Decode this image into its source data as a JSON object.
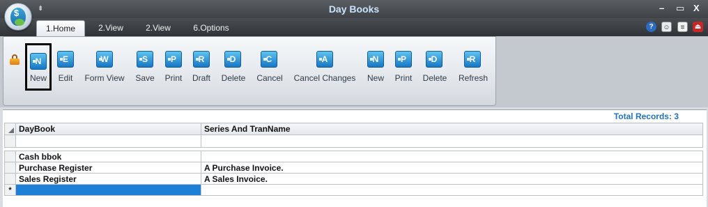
{
  "window": {
    "title": "Day Books",
    "controls": {
      "minimize": "–",
      "restore": "▭",
      "close": "X"
    },
    "qat_arrow": "⇟"
  },
  "tabs": [
    {
      "label": "1.Home",
      "active": true
    },
    {
      "label": "2.View",
      "active": false
    },
    {
      "label": "2.View",
      "active": false
    },
    {
      "label": "6.Options",
      "active": false
    }
  ],
  "topright_icons": [
    "help-icon",
    "contact-icon",
    "document-icon",
    "exit-icon"
  ],
  "ribbon": {
    "buttons": [
      {
        "label": "New",
        "letter": "N",
        "selected": true
      },
      {
        "label": "Edit",
        "letter": "E"
      },
      {
        "label": "Form View",
        "letter": "W"
      },
      {
        "label": "Save",
        "letter": "S"
      },
      {
        "label": "Print",
        "letter": "P"
      },
      {
        "label": "Draft",
        "letter": "R"
      },
      {
        "label": "Delete",
        "letter": "D"
      },
      {
        "label": "Cancel",
        "letter": "C"
      },
      {
        "label": "Cancel Changes",
        "letter": "A"
      },
      {
        "label": "New",
        "letter": "N"
      },
      {
        "label": "Print",
        "letter": "P"
      },
      {
        "label": "Delete",
        "letter": "D"
      },
      {
        "label": "Refresh",
        "letter": "R"
      }
    ]
  },
  "grid": {
    "total_records": "Total Records: 3",
    "columns": [
      "DayBook",
      "Series And TranName"
    ],
    "rows": [
      {
        "daybook": "Cash bbok",
        "series": ""
      },
      {
        "daybook": "Purchase Register",
        "series": "A Purchase Invoice."
      },
      {
        "daybook": "Sales Register",
        "series": "A Sales Invoice."
      }
    ],
    "new_row_marker": "*"
  },
  "colors": {
    "accent": "#1e73be",
    "selection": "#1e7fd6",
    "title_text": "#c9e3ff"
  }
}
